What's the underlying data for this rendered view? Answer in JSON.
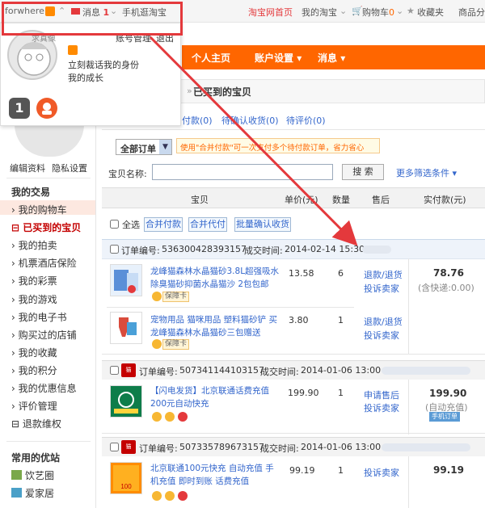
{
  "topbar": {
    "username": "forwhere",
    "messages_label": "消息",
    "messages_count": "1",
    "mobile_label": "手机逛淘宝",
    "home_link": "淘宝网首页",
    "my_taobao": "我的淘宝",
    "cart_label": "购物车",
    "cart_count": "0",
    "favorites": "收藏夹",
    "seller": "商品分"
  },
  "popup": {
    "nickname": "求真像",
    "account_link": "账号管理",
    "logout_link": "退出",
    "promo_line1": "立刻裁话我的身份",
    "promo_line2": "我的成长",
    "badge_level": "1"
  },
  "profile": {
    "edit_link": "编辑资料",
    "privacy_link": "隐私设置"
  },
  "nav": {
    "home": "个人主页",
    "settings": "账户设置",
    "messages": "消息"
  },
  "breadcrumb": "已买到的宝贝",
  "tabs": [
    {
      "label": "付款(0)"
    },
    {
      "label": "待确认收货(0)"
    },
    {
      "label": "待评价(0)"
    }
  ],
  "filter": {
    "all_orders": "全部订单",
    "merge_tip": "使用\"合并付款\"可一次支付多个待付款订单，省力省心",
    "search_label": "宝贝名称:",
    "search_button": "搜 索",
    "more_filters": "更多筛选条件"
  },
  "table_headers": {
    "item": "宝贝",
    "unit_price": "单价(元)",
    "quantity": "数量",
    "after_sale": "售后",
    "paid": "实付款(元)"
  },
  "bulk": {
    "select_all": "全选",
    "merge_pay": "合并付款",
    "merge_proxy": "合并代付",
    "batch_confirm": "批量确认收货"
  },
  "sidebar": {
    "section_title": "我的交易",
    "items": [
      "我的购物车",
      "已买到的宝贝",
      "我的拍卖",
      "机票酒店保险",
      "我的彩票",
      "我的游戏",
      "我的电子书",
      "购买过的店铺",
      "我的收藏",
      "我的积分",
      "我的优惠信息",
      "评价管理",
      "退款维权"
    ],
    "section2_title": "常用的优站",
    "section2_items": [
      "饮艺圈",
      "爱家居"
    ]
  },
  "orders": [
    {
      "order_no_label": "订单编号:",
      "order_no": "536300428393157",
      "time_label": "成交时间:",
      "time": "2014-02-14 15:30",
      "products": [
        {
          "title": "龙峰猫森林水晶猫砂3.8L超强吸水除臭猫砂抑菌水晶猫沙 2包包邮",
          "price": "13.58",
          "qty": "6",
          "badge": "保障卡"
        },
        {
          "title": "宠物用品 猫咪用品 塑料猫砂铲 买龙峰猫森林水晶猫砂三包赠送",
          "price": "3.80",
          "qty": "1",
          "badge": "保障卡"
        }
      ],
      "after_sale": [
        "退款/退货",
        "投诉卖家"
      ],
      "total": "78.76",
      "shipping_note": "(含快递:0.00)"
    },
    {
      "order_no_label": "订单编号:",
      "order_no": "507341144103157",
      "time_label": "成交时间:",
      "time": "2014-01-06 13:00",
      "products": [
        {
          "title": "【闪电发货】北京联通话费充值200元自动快充",
          "price": "199.90",
          "qty": "1",
          "badge": ""
        }
      ],
      "after_sale": [
        "申请售后",
        "投诉卖家"
      ],
      "total": "199.90",
      "shipping_note": "(自动充值)",
      "action_button": "手机订单"
    },
    {
      "order_no_label": "订单编号:",
      "order_no": "507335789673157",
      "time_label": "成交时间:",
      "time": "2014-01-06 13:00",
      "products": [
        {
          "title": "北京联通100元快充 自动充值 手机充值 即时到账 话费充值",
          "price": "99.19",
          "qty": "1",
          "badge": ""
        }
      ],
      "after_sale": [
        "投诉卖家"
      ],
      "total": "99.19"
    }
  ],
  "colors": {
    "accent": "#ff6600",
    "link": "#3366cc",
    "highlight": "#e4393c"
  }
}
